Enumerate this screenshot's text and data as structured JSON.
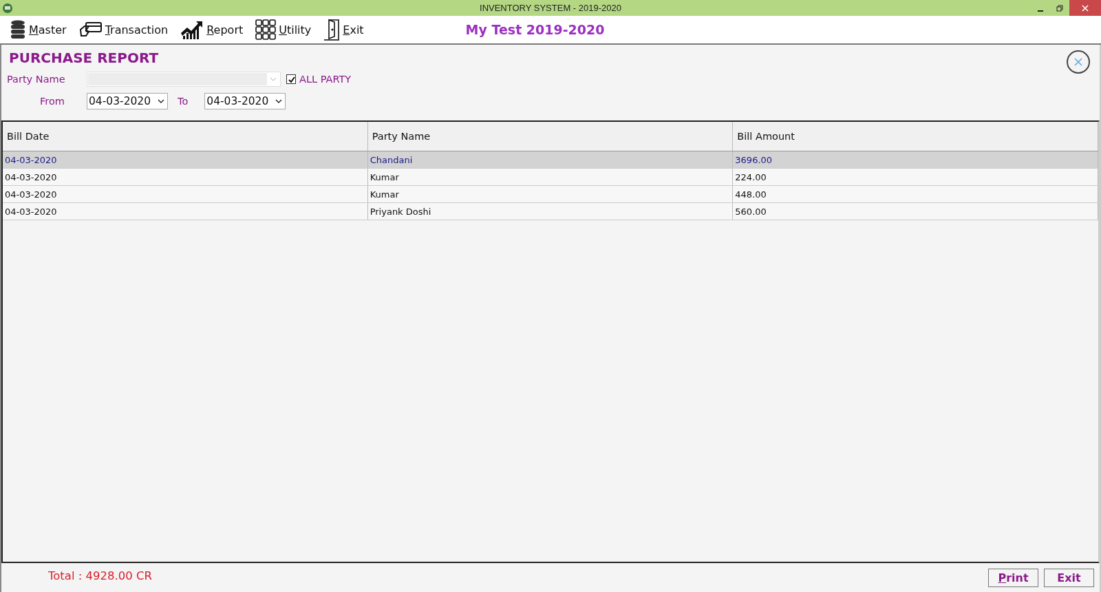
{
  "window": {
    "title": "INVENTORY SYSTEM - 2019-2020"
  },
  "menu": [
    {
      "label": "Master",
      "kind": "database"
    },
    {
      "label": "Transaction",
      "kind": "card"
    },
    {
      "label": "Report",
      "kind": "chart"
    },
    {
      "label": "Utility",
      "kind": "grid"
    },
    {
      "label": "Exit",
      "kind": "door"
    }
  ],
  "company": "My Test 2019-2020",
  "form": {
    "title": "PURCHASE REPORT",
    "party_label": "Party Name",
    "all_party": {
      "label": "ALL PARTY",
      "checked": true
    },
    "from_label": "From",
    "from": "04-03-2020",
    "to_label": "To",
    "to": "04-03-2020"
  },
  "table": {
    "columns": [
      "Bill Date",
      "Party Name",
      "Bill Amount"
    ],
    "rows": [
      {
        "cells": [
          "04-03-2020",
          "Chandani",
          "3696.00"
        ],
        "selected": true
      },
      {
        "cells": [
          "04-03-2020",
          "Kumar",
          "224.00"
        ],
        "selected": false
      },
      {
        "cells": [
          "04-03-2020",
          "Kumar",
          "448.00"
        ],
        "selected": false
      },
      {
        "cells": [
          "04-03-2020",
          "Priyank Doshi",
          "560.00"
        ],
        "selected": false
      }
    ]
  },
  "total": "Total : 4928.00 CR",
  "buttons": [
    "Print",
    "Exit"
  ]
}
